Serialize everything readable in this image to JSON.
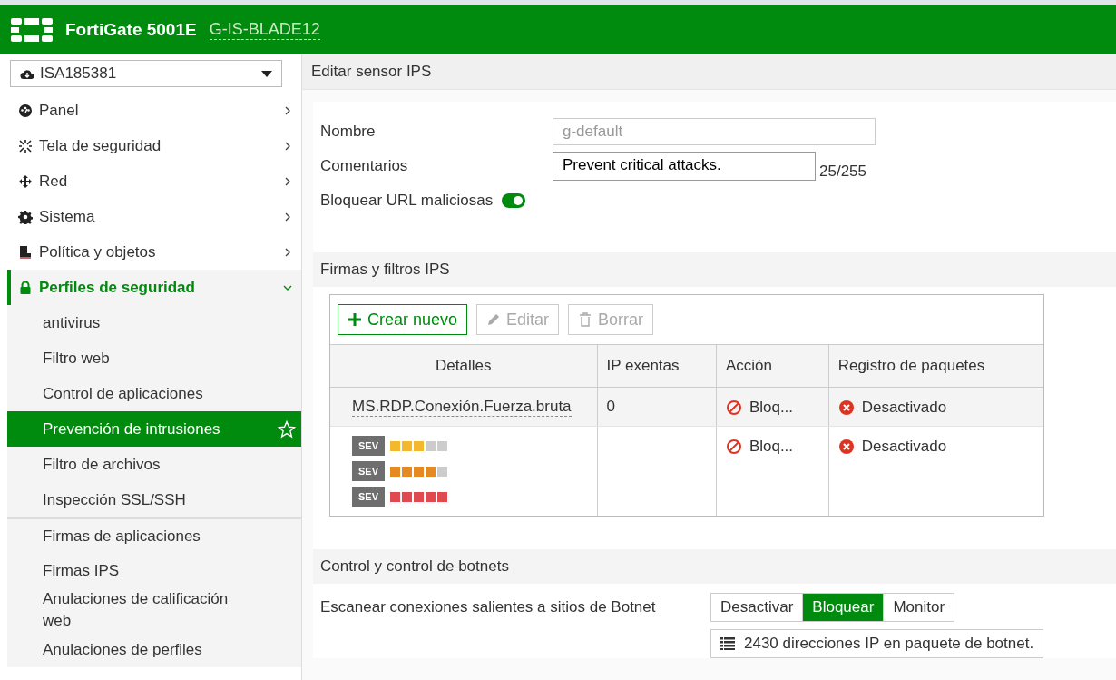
{
  "header": {
    "product": "FortiGate 5001E",
    "hostname": "G-IS-BLADE12"
  },
  "sidebar": {
    "vdom": "ISA185381",
    "items": [
      {
        "label": "Panel",
        "kind": "dashboard",
        "expanded": false
      },
      {
        "label": "Tela de seguridad",
        "kind": "fabric",
        "expanded": false
      },
      {
        "label": "Red",
        "kind": "network",
        "expanded": false
      },
      {
        "label": "Sistema",
        "kind": "system",
        "expanded": false
      },
      {
        "label": "Política y objetos",
        "kind": "policy",
        "expanded": false
      },
      {
        "label": "Perfiles de seguridad",
        "kind": "security",
        "expanded": true,
        "children": [
          {
            "label": "antivirus",
            "selected": false
          },
          {
            "label": "Filtro web",
            "selected": false
          },
          {
            "label": "Control de aplicaciones",
            "selected": false
          },
          {
            "label": "Prevención de intrusiones",
            "selected": true
          },
          {
            "label": "Filtro de archivos",
            "selected": false
          },
          {
            "label": "Inspección SSL/SSH",
            "selected": false
          },
          {
            "label": "Firmas de aplicaciones",
            "selected": false,
            "separator_before": true
          },
          {
            "label": "Firmas IPS",
            "selected": false
          },
          {
            "label": "Anulaciones de calificación web",
            "selected": false
          },
          {
            "label": "Anulaciones de perfiles",
            "selected": false
          }
        ]
      }
    ]
  },
  "page_title": "Editar sensor IPS",
  "form": {
    "name_label": "Nombre",
    "name_placeholder": "g-default",
    "comments_label": "Comentarios",
    "comments_value": "Prevent critical attacks.",
    "comments_count": "25/255",
    "malicious_url_label": "Bloquear URL maliciosas",
    "malicious_url_on": true
  },
  "signatures": {
    "title": "Firmas y filtros IPS",
    "toolbar": [
      {
        "label": "Crear nuevo",
        "kind": "create",
        "disabled": false
      },
      {
        "label": "Editar",
        "kind": "edit",
        "disabled": true
      },
      {
        "label": "Borrar",
        "kind": "delete",
        "disabled": true
      }
    ],
    "table": {
      "columns": [
        "Detalles",
        "IP exentas",
        "Acción",
        "Registro de paquetes"
      ],
      "rows": [
        {
          "kind": "signature",
          "details": "MS.RDP.Conexión.Fuerza.bruta",
          "exempt_ips": "0",
          "action": "Bloq...",
          "packet_log": "Desactivado"
        },
        {
          "kind": "filter",
          "severities": [
            {
              "badge": "SEV",
              "stars": 3,
              "color": "#f3b82c"
            },
            {
              "badge": "SEV",
              "stars": 4,
              "color": "#e58a22"
            },
            {
              "badge": "SEV",
              "stars": 5,
              "color": "#e0494f"
            }
          ],
          "action": "Bloq...",
          "packet_log": "Desactivado"
        }
      ]
    }
  },
  "botnet": {
    "title": "Control y control de botnets",
    "scan_label": "Escanear conexiones salientes a sitios de Botnet",
    "options": [
      {
        "label": "Desactivar",
        "selected": false
      },
      {
        "label": "Bloquear",
        "selected": true
      },
      {
        "label": "Monitor",
        "selected": false
      }
    ],
    "package_info": "2430 direcciones IP en paquete de botnet."
  }
}
